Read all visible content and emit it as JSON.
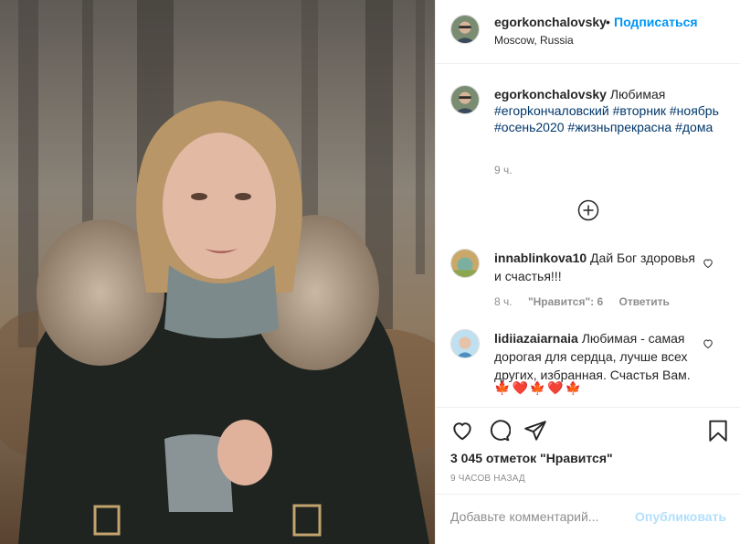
{
  "header": {
    "username": "egorkonchalovsky",
    "dot": "•",
    "follow_label": "Подписаться",
    "location": "Moscow, Russia"
  },
  "caption": {
    "username": "egorkonchalovsky",
    "text": "Любимая",
    "tags": "#егорkончаловский #вторник #ноябрь #осень2020 #жизньпрекрасна #дома",
    "time": "9 ч."
  },
  "load_more_icon": "plus-circle-icon",
  "comments": [
    {
      "username": "innablinkova10",
      "text": "Дай Бог здоровья и счастья!!!",
      "time": "8 ч.",
      "likes": "\"Нравится\": 6",
      "reply_label": "Ответить"
    },
    {
      "username": "lidiiazaiarnaia",
      "text": "Любимая - самая дорогая для сердца, лучше всех других, избранная. Счастья Вам.",
      "emojis": [
        "🍁",
        "❤️",
        "🍁",
        "❤️",
        "🍁"
      ]
    }
  ],
  "actions": {
    "like_icon": "heart-icon",
    "comment_icon": "comment-icon",
    "share_icon": "send-icon",
    "save_icon": "bookmark-icon"
  },
  "likes_text": "3 045 отметок \"Нравится\"",
  "time_ago": "9 ЧАСОВ НАЗАД",
  "add_comment": {
    "placeholder": "Добавьте комментарий...",
    "post_label": "Опубликовать"
  },
  "colors": {
    "link_blue": "#0095f6",
    "tag_blue": "#00376b",
    "muted": "#8e8e8e",
    "post_disabled": "#b2dffc"
  }
}
